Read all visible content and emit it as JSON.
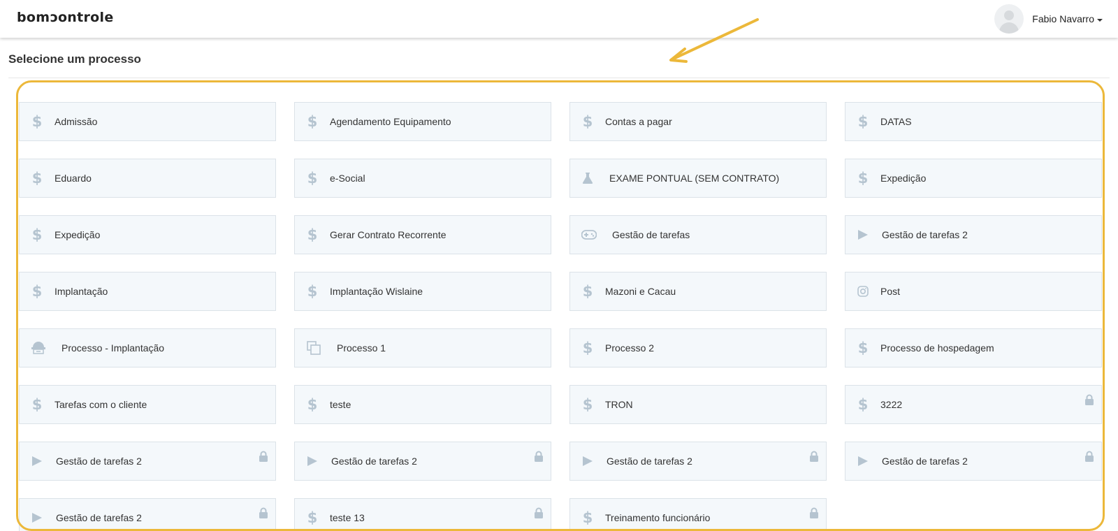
{
  "header": {
    "logo_text_a": "bom",
    "logo_text_o": "c",
    "logo_text_b": "ontrole",
    "user_name": "Fabio Navarro"
  },
  "page": {
    "title": "Selecione um processo"
  },
  "colors": {
    "highlight": "#ecb83a",
    "icon": "#b5c4d0",
    "card_bg": "#f4f8fb"
  },
  "processes": [
    {
      "label": "Admissão",
      "icon": "dollar-icon",
      "locked": false
    },
    {
      "label": "Agendamento Equipamento",
      "icon": "dollar-icon",
      "locked": false
    },
    {
      "label": "Contas a pagar",
      "icon": "dollar-icon",
      "locked": false
    },
    {
      "label": "DATAS",
      "icon": "dollar-icon",
      "locked": false
    },
    {
      "label": "Eduardo",
      "icon": "dollar-icon",
      "locked": false
    },
    {
      "label": "e-Social",
      "icon": "dollar-icon",
      "locked": false
    },
    {
      "label": "EXAME PONTUAL (SEM CONTRATO)",
      "icon": "flask-icon",
      "locked": false
    },
    {
      "label": "Expedição",
      "icon": "dollar-icon",
      "locked": false
    },
    {
      "label": "Expedição",
      "icon": "dollar-icon",
      "locked": false
    },
    {
      "label": "Gerar Contrato Recorrente",
      "icon": "dollar-icon",
      "locked": false
    },
    {
      "label": "Gestão de tarefas",
      "icon": "gamepad-icon",
      "locked": false
    },
    {
      "label": "Gestão de tarefas 2",
      "icon": "play-icon",
      "locked": false
    },
    {
      "label": "Implantação",
      "icon": "dollar-icon",
      "locked": false
    },
    {
      "label": "Implantação Wislaine",
      "icon": "dollar-icon",
      "locked": false
    },
    {
      "label": "Mazoni e Cacau",
      "icon": "dollar-icon",
      "locked": false
    },
    {
      "label": "Post",
      "icon": "instagram-icon",
      "locked": false
    },
    {
      "label": "Processo - Implantação",
      "icon": "builder-icon",
      "locked": false
    },
    {
      "label": "Processo 1",
      "icon": "copy-icon",
      "locked": false
    },
    {
      "label": "Processo 2",
      "icon": "dollar-icon",
      "locked": false
    },
    {
      "label": "Processo de hospedagem",
      "icon": "dollar-icon",
      "locked": false
    },
    {
      "label": "Tarefas com o cliente",
      "icon": "dollar-icon",
      "locked": false
    },
    {
      "label": "teste",
      "icon": "dollar-icon",
      "locked": false
    },
    {
      "label": "TRON",
      "icon": "dollar-icon",
      "locked": false
    },
    {
      "label": "3222",
      "icon": "dollar-icon",
      "locked": true
    },
    {
      "label": "Gestão de tarefas 2",
      "icon": "play-icon",
      "locked": true
    },
    {
      "label": "Gestão de tarefas 2",
      "icon": "play-icon",
      "locked": true
    },
    {
      "label": "Gestão de tarefas 2",
      "icon": "play-icon",
      "locked": true
    },
    {
      "label": "Gestão de tarefas 2",
      "icon": "play-icon",
      "locked": true
    },
    {
      "label": "Gestão de tarefas 2",
      "icon": "play-icon",
      "locked": true
    },
    {
      "label": "teste 13",
      "icon": "dollar-icon",
      "locked": true
    },
    {
      "label": "Treinamento funcionário",
      "icon": "dollar-icon",
      "locked": true
    }
  ]
}
